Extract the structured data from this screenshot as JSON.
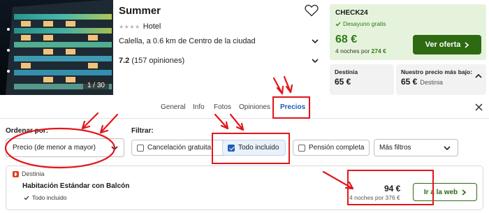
{
  "hotel": {
    "name": "Summer",
    "category": "Hotel",
    "location": "Calella, a 0.6 km de Centro de la ciudad",
    "rating_score": "7.2",
    "rating_count": "(157 opiniones)",
    "photo_counter": "1 / 30",
    "stars_glyphs": "★★★★"
  },
  "offer": {
    "provider": "CHECK24",
    "feature": "Desayuno gratis",
    "price": "68 €",
    "nights_prefix": "4 noches por",
    "nights_total": "274 €",
    "button_label": "Ver oferta"
  },
  "comparison": {
    "first": {
      "label": "Destinia",
      "price": "65 €"
    },
    "best": {
      "label": "Nuestro precio más bajo:",
      "price": "65 €",
      "provider": "Destinia"
    }
  },
  "tabs": [
    "General",
    "Info",
    "Fotos",
    "Opiniones",
    "Precios"
  ],
  "active_tab": "Precios",
  "filters": {
    "sort_label": "Ordenar por:",
    "sort_value": "Precio (de menor a mayor)",
    "filter_label": "Filtrar:",
    "chips": [
      {
        "label": "Cancelación gratuita",
        "checked": false
      },
      {
        "label": "Todo incluido",
        "checked": true
      },
      {
        "label": "Pensión completa",
        "checked": false
      }
    ],
    "more_label": "Más filtros"
  },
  "deal": {
    "provider": "Destinia",
    "room": "Habitación Estándar con Balcón",
    "included": "Todo incluido",
    "price": "94 €",
    "nights": "4 noches por 376 €",
    "button_label": "Ir a la web"
  },
  "colors": {
    "accent_green": "#2d6a12",
    "offer_bg": "#e6f3dc",
    "active_tab": "#1f5bb8",
    "annotation_red": "#e3151b"
  }
}
